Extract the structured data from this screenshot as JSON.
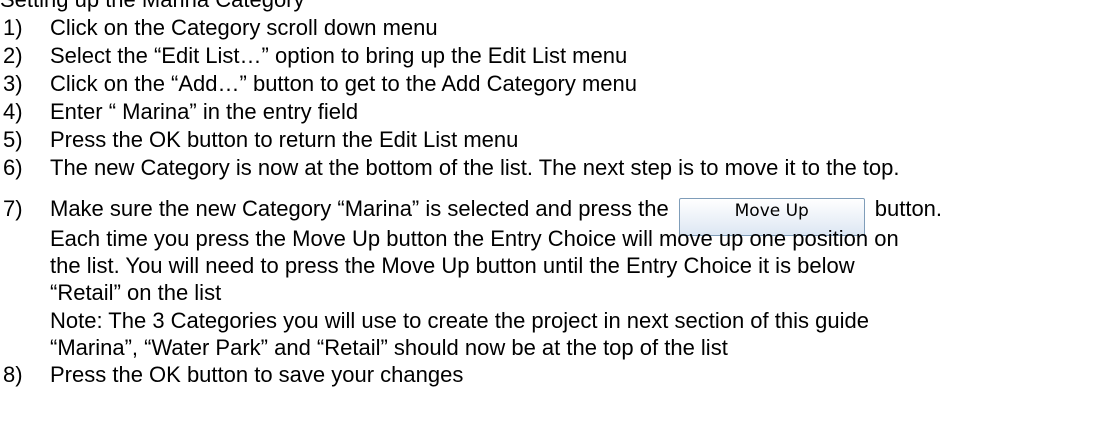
{
  "heading": "Setting up the Marina Category",
  "steps": [
    {
      "num": "1)",
      "text": "Click on the Category scroll down menu"
    },
    {
      "num": "2)",
      "text": "Select the “Edit List…” option to bring up the Edit List menu"
    },
    {
      "num": "3)",
      "text": "Click on the “Add…” button to get to the Add Category menu"
    },
    {
      "num": "4)",
      "text": "Enter “ Marina” in the entry field"
    },
    {
      "num": "5)",
      "text": "Press the OK button to return the Edit List menu"
    },
    {
      "num": "6)",
      "text": "The new Category is now at the bottom of the list. The next step is to move it to the top."
    },
    {
      "num": "7)",
      "text_before": "Make sure the new Category “Marina” is selected and press the",
      "button_label": "Move Up",
      "text_after": "button."
    },
    {
      "num": "8)",
      "text": "Press the OK button to save your changes"
    }
  ],
  "step7_paragraph": [
    "Each time you press the Move Up button the Entry Choice will move up one position on",
    "the list. You will need to press the Move Up button until the Entry Choice it is below",
    "“Retail” on the list"
  ],
  "note": [
    "Note: The 3 Categories you will use to create the project in next section of this guide",
    "“Marina”, “Water Park” and “Retail” should now be at the top of the list"
  ]
}
